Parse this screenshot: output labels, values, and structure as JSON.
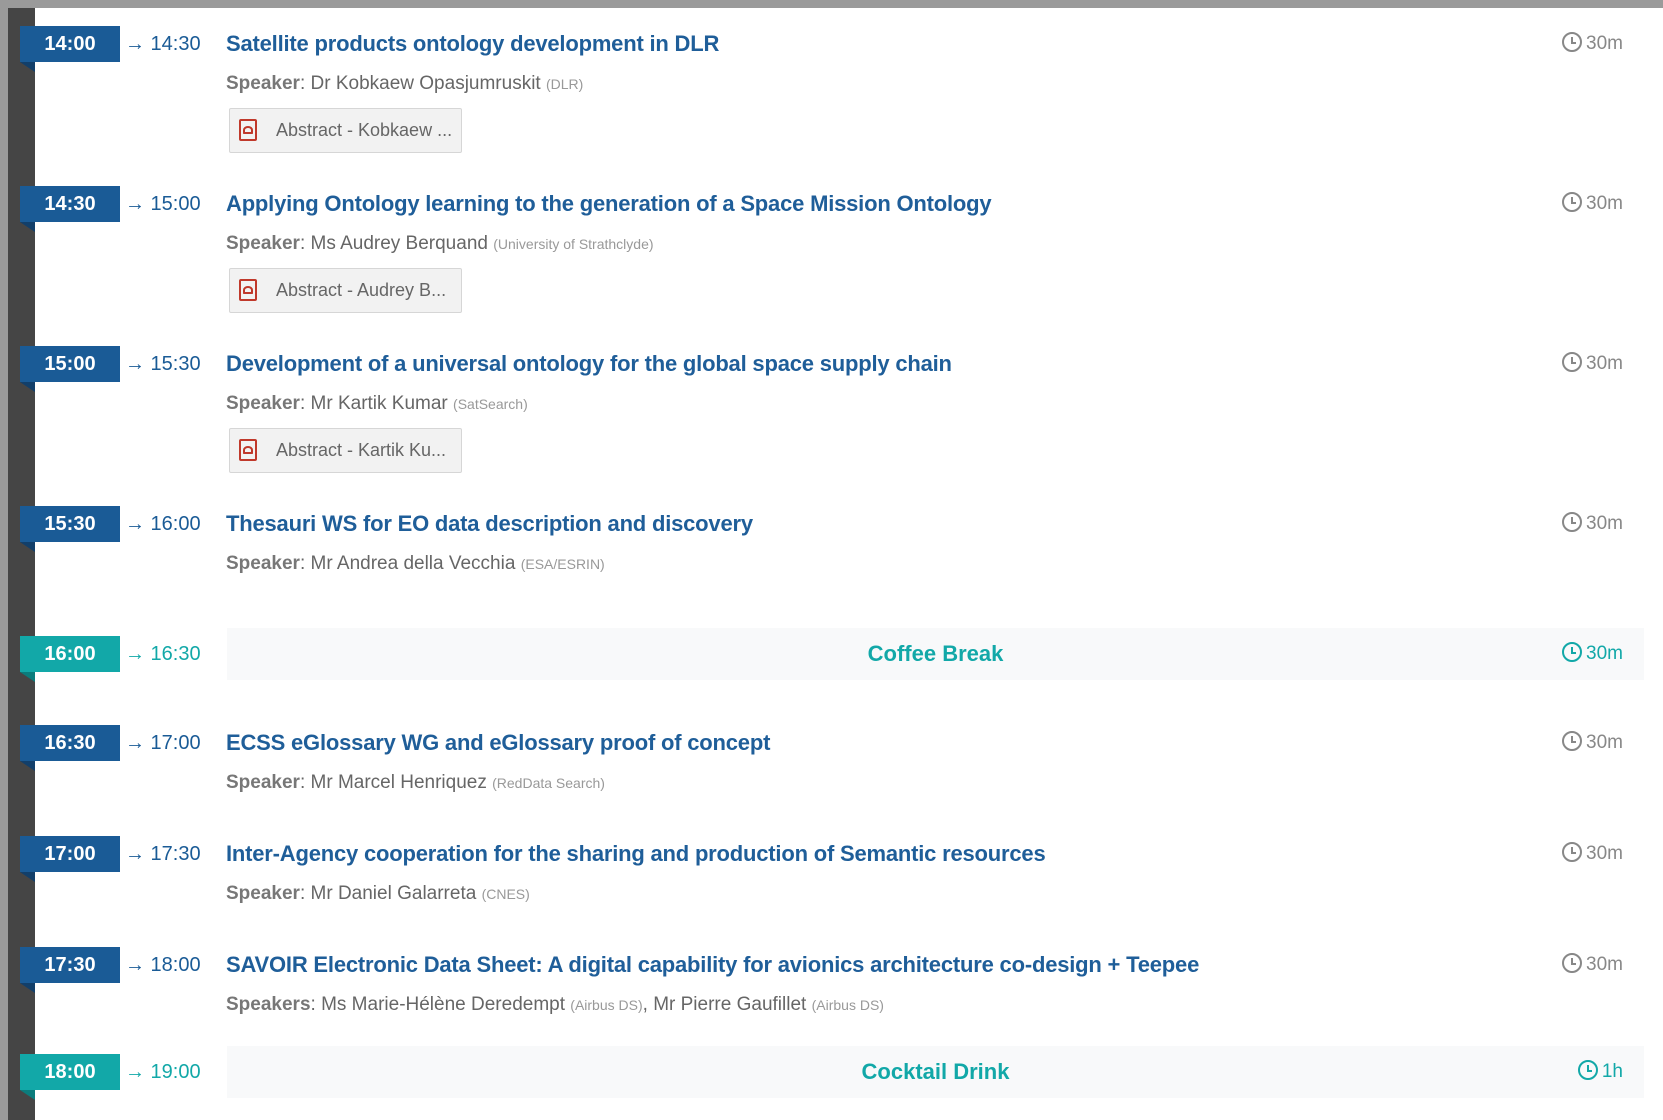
{
  "entries": [
    {
      "start": "14:00",
      "end": "→ 14:30",
      "title": "Satellite products ontology development in DLR",
      "duration": "30m",
      "speaker_label": "Speaker",
      "speaker_name": "Dr Kobkaew Opasjumruskit",
      "speaker_aff": "(DLR)",
      "abstract": "Abstract - Kobkaew ..."
    },
    {
      "start": "14:30",
      "end": "→ 15:00",
      "title": "Applying Ontology learning to the generation of a Space Mission Ontology",
      "duration": "30m",
      "speaker_label": "Speaker",
      "speaker_name": "Ms Audrey Berquand",
      "speaker_aff": "(University of Strathclyde)",
      "abstract": "Abstract - Audrey B..."
    },
    {
      "start": "15:00",
      "end": "→ 15:30",
      "title": "Development of a universal ontology for the global space supply chain",
      "duration": "30m",
      "speaker_label": "Speaker",
      "speaker_name": "Mr Kartik Kumar",
      "speaker_aff": "(SatSearch)",
      "abstract": "Abstract - Kartik Ku..."
    },
    {
      "start": "15:30",
      "end": "→ 16:00",
      "title": "Thesauri WS for EO data description and discovery",
      "duration": "30m",
      "speaker_label": "Speaker",
      "speaker_name": "Mr Andrea della Vecchia",
      "speaker_aff": "(ESA/ESRIN)"
    },
    {
      "start": "16:00",
      "end": "→ 16:30",
      "title": "Coffee Break",
      "duration": "30m"
    },
    {
      "start": "16:30",
      "end": "→ 17:00",
      "title": "ECSS eGlossary WG and eGlossary proof of concept",
      "duration": "30m",
      "speaker_label": "Speaker",
      "speaker_name": "Mr Marcel Henriquez",
      "speaker_aff": "(RedData Search)"
    },
    {
      "start": "17:00",
      "end": "→ 17:30",
      "title": "Inter-Agency cooperation for the sharing and production of Semantic resources",
      "duration": "30m",
      "speaker_label": "Speaker",
      "speaker_name": "Mr Daniel Galarreta",
      "speaker_aff": "(CNES)"
    },
    {
      "start": "17:30",
      "end": "→ 18:00",
      "title": "SAVOIR Electronic Data Sheet: A digital capability for avionics architecture co-design + Teepee",
      "duration": "30m",
      "speaker_label": "Speakers",
      "speaker_name": "Ms Marie-Hélène Deredempt",
      "speaker_aff": "(Airbus DS)",
      "speaker2_name": "Mr Pierre Gaufillet",
      "speaker2_aff": "(Airbus DS)"
    },
    {
      "start": "18:00",
      "end": "→ 19:00",
      "title": "Cocktail Drink",
      "duration": "1h"
    }
  ]
}
